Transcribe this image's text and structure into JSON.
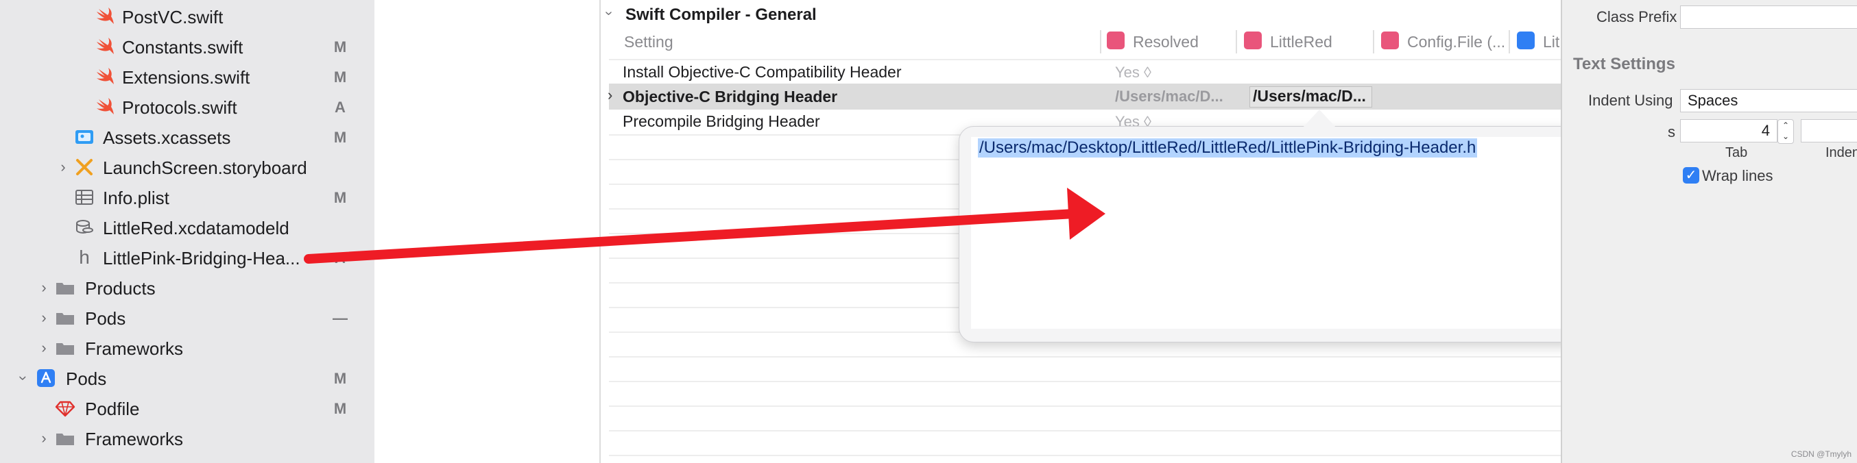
{
  "navigator": {
    "items": [
      {
        "label": "PostVC.swift",
        "badge": "",
        "icon": "swift-icon"
      },
      {
        "label": "Constants.swift",
        "badge": "M",
        "icon": "swift-icon"
      },
      {
        "label": "Extensions.swift",
        "badge": "M",
        "icon": "swift-icon"
      },
      {
        "label": "Protocols.swift",
        "badge": "A",
        "icon": "swift-icon"
      },
      {
        "label": "Assets.xcassets",
        "badge": "M",
        "icon": "asset-catalog-icon"
      },
      {
        "label": "LaunchScreen.storyboard",
        "badge": "",
        "icon": "storyboard-icon"
      },
      {
        "label": "Info.plist",
        "badge": "M",
        "icon": "plist-icon"
      },
      {
        "label": "LittleRed.xcdatamodeld",
        "badge": "",
        "icon": "datamodel-icon"
      },
      {
        "label": "LittlePink-Bridging-Hea...",
        "badge": "A",
        "icon": "header-file-icon"
      },
      {
        "label": "Products",
        "badge": "",
        "icon": "folder-icon"
      },
      {
        "label": "Pods",
        "badge": "—",
        "icon": "folder-icon"
      },
      {
        "label": "Frameworks",
        "badge": "",
        "icon": "folder-icon"
      },
      {
        "label": "Pods",
        "badge": "M",
        "icon": "project-icon"
      },
      {
        "label": "Podfile",
        "badge": "M",
        "icon": "ruby-icon"
      },
      {
        "label": "Frameworks",
        "badge": "",
        "icon": "folder-icon"
      }
    ]
  },
  "build_settings": {
    "section_title": "Swift Compiler - General",
    "columns": {
      "setting": "Setting",
      "resolved": "Resolved",
      "target": "LittleRed",
      "config": "Config.File (...",
      "extra": "Lit"
    },
    "rows": [
      {
        "name": "Install Objective-C Compatibility Header",
        "resolved": "Yes ◊"
      },
      {
        "name": "Objective-C Bridging Header",
        "resolved": "/Users/mac/D...",
        "target": "/Users/mac/D..."
      },
      {
        "name": "Precompile Bridging Header",
        "resolved": "Yes ◊"
      }
    ]
  },
  "popover": {
    "value": "/Users/mac/Desktop/LittleRed/LittleRed/LittlePink-Bridging-Header.h"
  },
  "inspector": {
    "class_prefix_label": "Class Prefix",
    "text_settings_title": "Text Settings",
    "indent_using_label": "Indent Using",
    "indent_using_value": "Spaces",
    "widths_label": "s",
    "tab_value": "4",
    "tab_label": "Tab",
    "indent_label": "Inden",
    "wrap_lines_label": "Wrap lines"
  },
  "watermark": "CSDN @Tmylyh",
  "colors": {
    "accent": "#2f7ff4",
    "arrow": "#ee1c25",
    "swift": "#f05138"
  }
}
